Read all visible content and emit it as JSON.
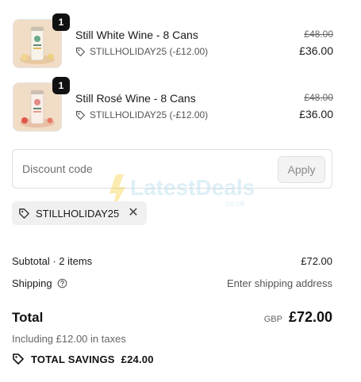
{
  "line_items": [
    {
      "name": "Still White Wine - 8 Cans",
      "quantity": "1",
      "discount": "STILLHOLIDAY25 (-£12.00)",
      "original_price": "£48.00",
      "price": "£36.00",
      "image": "white-wine-can"
    },
    {
      "name": "Still Rosé Wine - 8 Cans",
      "quantity": "1",
      "discount": "STILLHOLIDAY25 (-£12.00)",
      "original_price": "£48.00",
      "price": "£36.00",
      "image": "rose-wine-can"
    }
  ],
  "discount_form": {
    "placeholder": "Discount code",
    "apply_label": "Apply"
  },
  "applied_code": {
    "code": "STILLHOLIDAY25",
    "remove_icon": "close-icon"
  },
  "watermark": {
    "text": "LatestDeals",
    "subtext": ".co.uk"
  },
  "summary": {
    "subtotal_label": "Subtotal · 2 items",
    "subtotal_value": "£72.00",
    "shipping_label": "Shipping",
    "shipping_value": "Enter shipping address",
    "total_label": "Total",
    "currency": "GBP",
    "total_value": "£72.00",
    "tax_note": "Including £12.00 in taxes",
    "savings_label": "TOTAL SAVINGS",
    "savings_value": "£24.00"
  },
  "colors": {
    "accent_dark": "#111111",
    "muted_text": "#666666",
    "watermark": "#f5c518"
  }
}
